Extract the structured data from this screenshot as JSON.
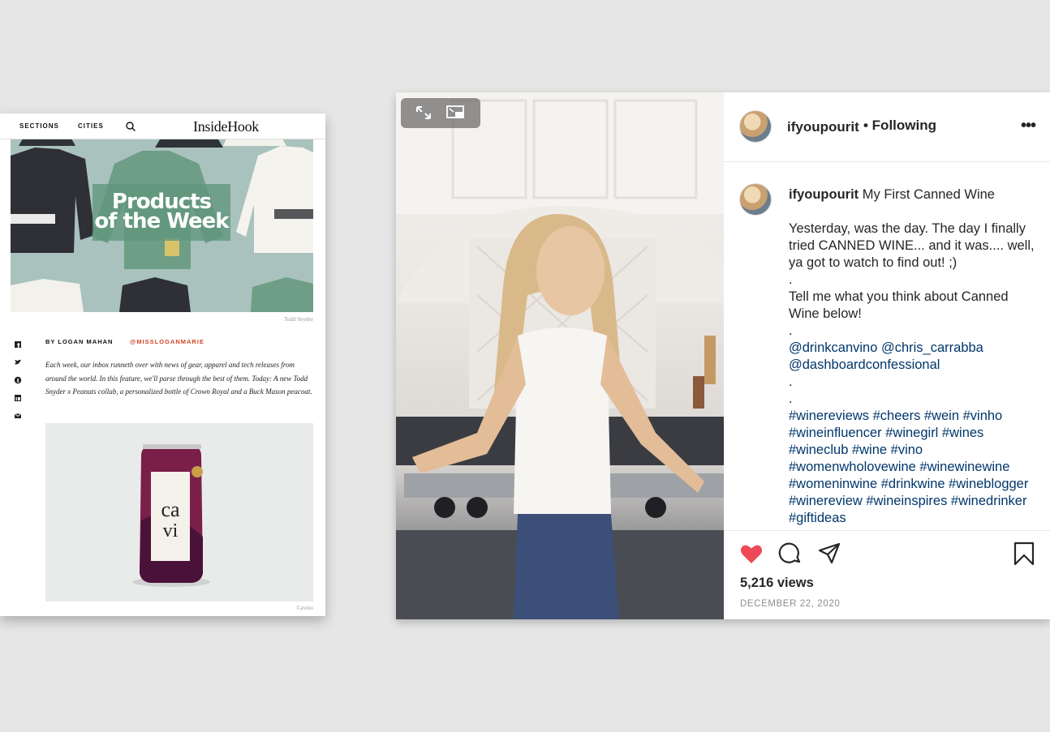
{
  "insidehook": {
    "nav": {
      "sections": "SECTIONS",
      "cities": "CITIES",
      "logo": "InsideHook"
    },
    "hero": {
      "title_line1": "Products",
      "title_line2": "of the Week",
      "photo_credit": "Todd Snyder"
    },
    "byline": "BY LOGAN MAHAN",
    "handle": "@MISSLOGANMARIE",
    "intro": "Each week, our inbox runneth over with news of gear, apparel and tech releases from around the world. In this feature, we'll parse through the best of them. Today: A new Todd Snyder x Peanuts collab, a personalized bottle of Crown Royal and a Buck Mason peacoat.",
    "product_credit": "Cavino",
    "share_icons": [
      "facebook-icon",
      "twitter-icon",
      "pinterest-icon",
      "linkedin-icon",
      "email-icon"
    ]
  },
  "instagram": {
    "username": "ifyoupourit",
    "follow_status": "• Following",
    "caption_title": "My First Canned Wine",
    "caption_body": "Yesterday, was the day. The day I finally tried CANNED WINE... and it was.... well, ya got to watch to find out! ;)\n.\nTell me what you think about Canned Wine below!\n.",
    "mentions": "@drinkcanvino @chris_carrabba @dashboardconfessional",
    "separators": ".\n.",
    "hashtags": "#winereviews #cheers #wein #vinho #wineinfluencer #winegirl #wines #wineclub #wine #vino #womenwholovewine #winewinewine #womeninwine #drinkwine #wineblogger #winereview #wineinspires #winedrinker #giftideas",
    "views": "5,216 views",
    "date": "DECEMBER 22, 2020",
    "colors": {
      "like": "#ed4956",
      "link": "#00376b",
      "text": "#262626",
      "muted": "#8e8e8e"
    }
  }
}
